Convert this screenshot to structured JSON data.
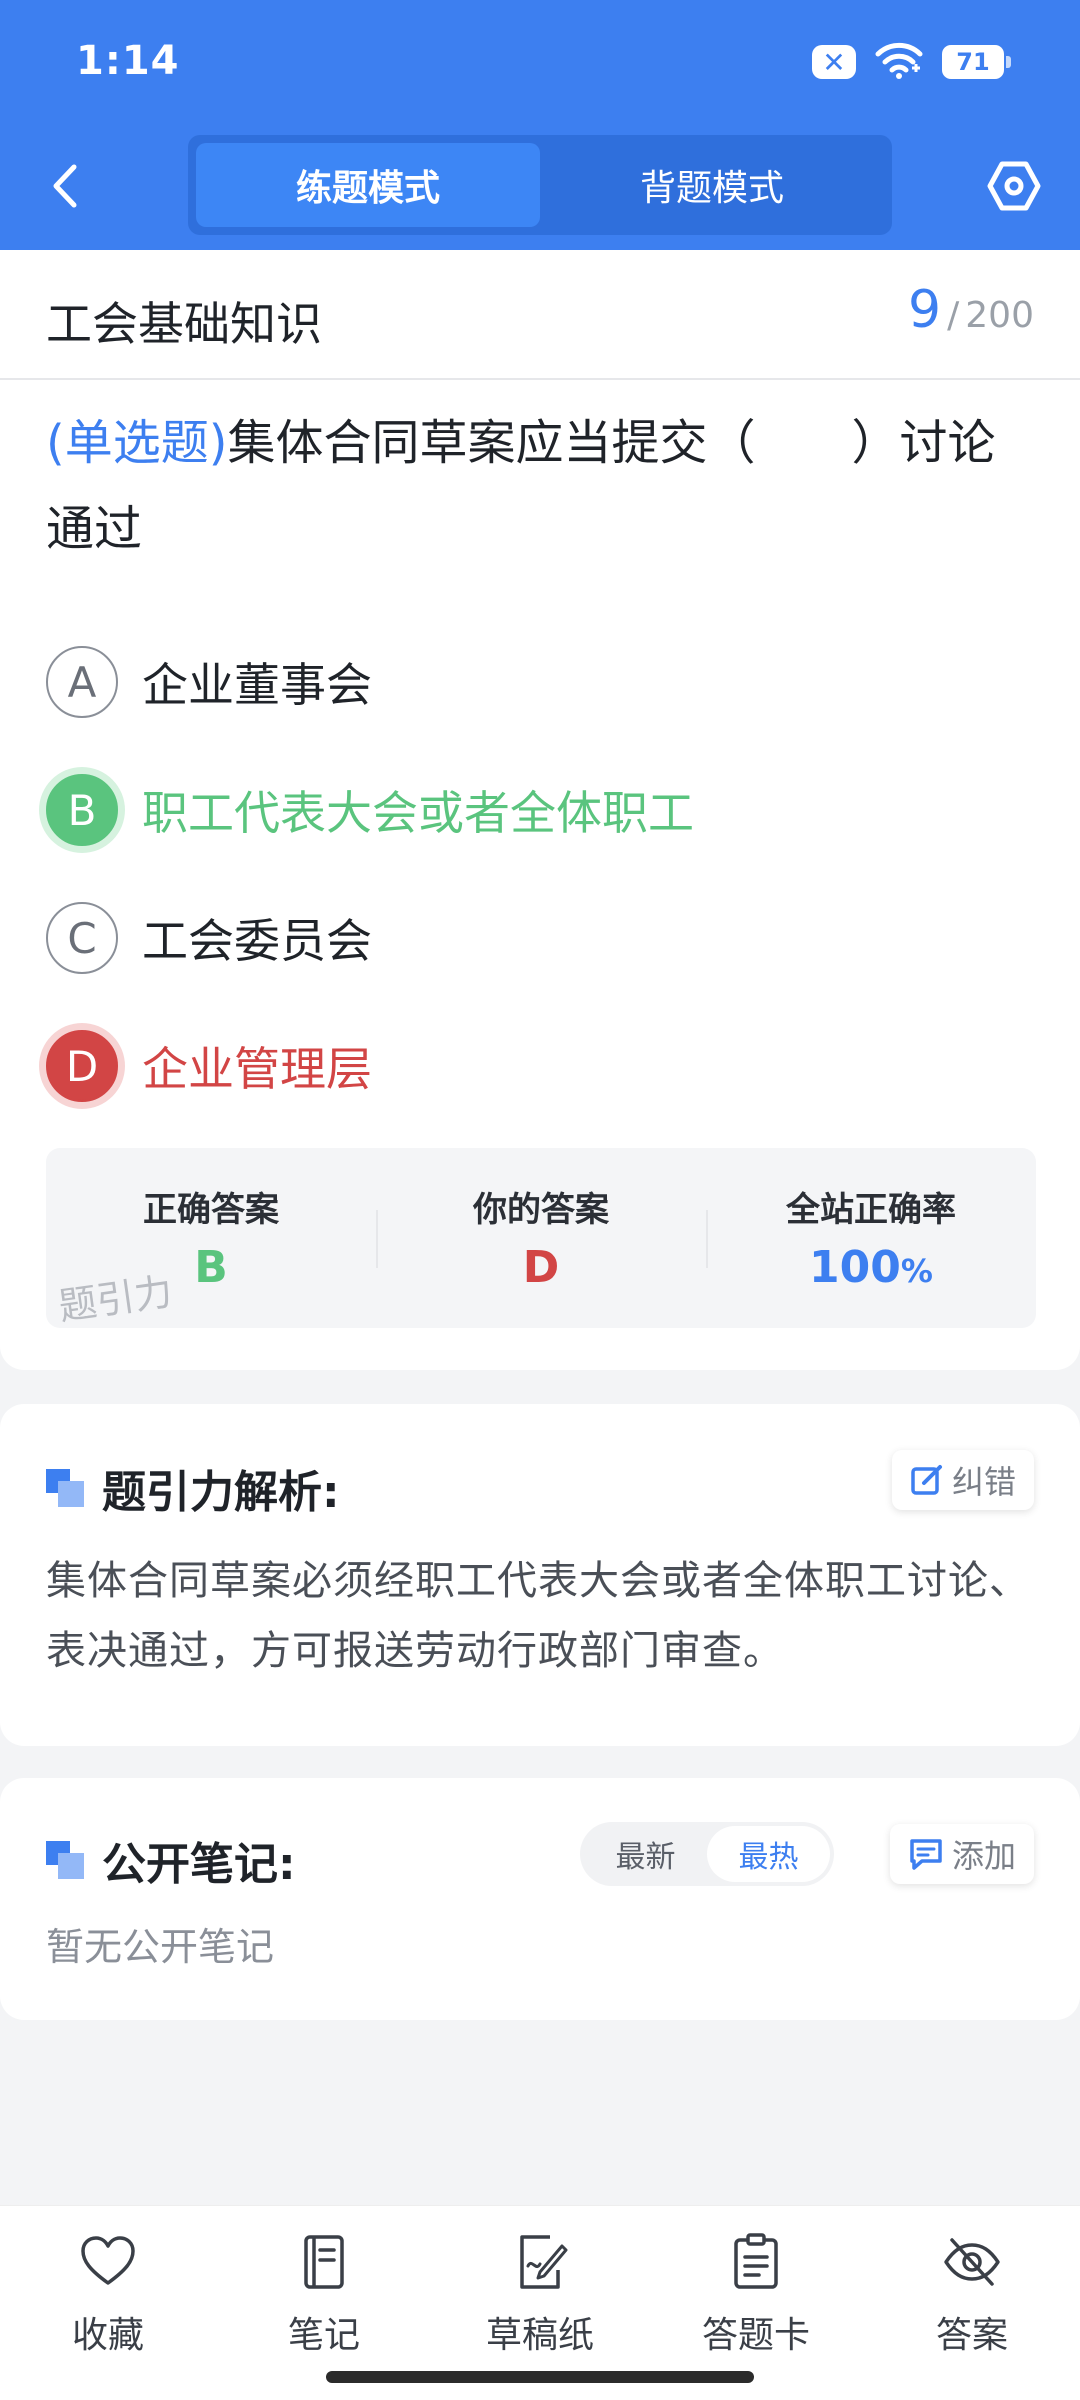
{
  "status_bar": {
    "time": "1:14",
    "battery": "71"
  },
  "header": {
    "tabs": [
      {
        "label": "练题模式",
        "active": true
      },
      {
        "label": "背题模式",
        "active": false
      }
    ]
  },
  "subject": {
    "title": "工会基础知识",
    "current": "9",
    "total": "200"
  },
  "question": {
    "type": "(单选题)",
    "text": "集体合同草案应当提交（　　）讨论通过"
  },
  "options": [
    {
      "letter": "A",
      "text": "企业董事会",
      "state": "normal"
    },
    {
      "letter": "B",
      "text": "职工代表大会或者全体职工",
      "state": "correct"
    },
    {
      "letter": "C",
      "text": "工会委员会",
      "state": "normal"
    },
    {
      "letter": "D",
      "text": "企业管理层",
      "state": "wrong"
    }
  ],
  "summary": {
    "correct_label": "正确答案",
    "correct_value": "B",
    "yours_label": "你的答案",
    "yours_value": "D",
    "rate_label": "全站正确率",
    "rate_value": "100",
    "rate_unit": "%",
    "watermark": "题引力"
  },
  "analysis": {
    "title": "题引力解析:",
    "report_label": "纠错",
    "text": "集体合同草案必须经职工代表大会或者全体职工讨论、表决通过，方可报送劳动行政部门审查。"
  },
  "notes": {
    "title": "公开笔记:",
    "sort_latest": "最新",
    "sort_hot": "最热",
    "add_label": "添加",
    "empty_text": "暂无公开笔记"
  },
  "bottom_tabs": [
    {
      "label": "收藏",
      "icon": "heart-icon"
    },
    {
      "label": "笔记",
      "icon": "notebook-icon"
    },
    {
      "label": "草稿纸",
      "icon": "draft-paper-icon"
    },
    {
      "label": "答题卡",
      "icon": "answer-card-icon"
    },
    {
      "label": "答案",
      "icon": "eye-off-icon"
    }
  ],
  "colors": {
    "primary": "#3d7ff0",
    "correct": "#5ac47e",
    "wrong": "#d24545"
  }
}
